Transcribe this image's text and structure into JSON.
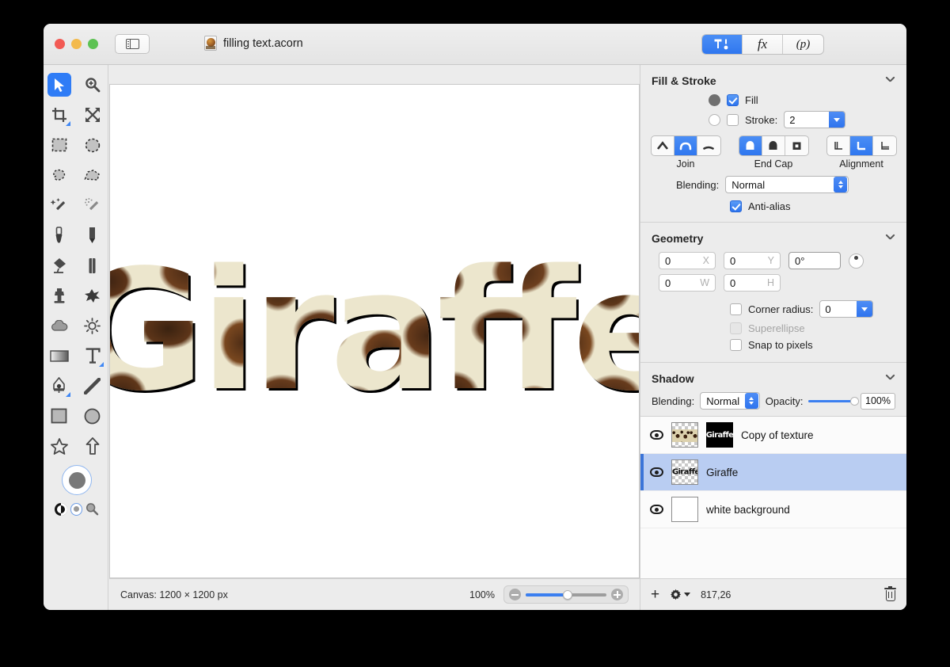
{
  "titlebar": {
    "document_name": "filling text.acorn",
    "sidebar_toggle_icon": "sidebar-icon",
    "segments": [
      {
        "id": "tools",
        "label": "",
        "icon": "hammer-pen-icon",
        "selected": true
      },
      {
        "id": "effects",
        "label": "fx",
        "icon": "fx-icon",
        "selected": false
      },
      {
        "id": "presets",
        "label": "(p)",
        "icon": "p-icon",
        "selected": false
      }
    ]
  },
  "tools": {
    "rows": [
      [
        {
          "name": "move-tool",
          "icon": "arrow-cursor-icon",
          "selected": true
        },
        {
          "name": "zoom-tool",
          "icon": "magnifier-plus-icon",
          "selected": false
        }
      ],
      [
        {
          "name": "crop-tool",
          "icon": "crop-icon",
          "selected": false,
          "badge": true
        },
        {
          "name": "transform-tool",
          "icon": "arrows-expand-icon",
          "selected": false
        }
      ],
      [
        {
          "name": "rect-select-tool",
          "icon": "rect-marquee-icon",
          "selected": false
        },
        {
          "name": "ellipse-select-tool",
          "icon": "ellipse-marquee-icon",
          "selected": false
        }
      ],
      [
        {
          "name": "lasso-tool",
          "icon": "lasso-icon",
          "selected": false
        },
        {
          "name": "polygon-lasso-tool",
          "icon": "polygon-lasso-icon",
          "selected": false
        }
      ],
      [
        {
          "name": "magic-wand-tool",
          "icon": "magic-wand-icon",
          "selected": false
        },
        {
          "name": "instant-alpha-tool",
          "icon": "instant-alpha-icon",
          "selected": false
        }
      ],
      [
        {
          "name": "brush-tool",
          "icon": "brush-icon",
          "selected": false
        },
        {
          "name": "pencil-tool",
          "icon": "pencil-icon",
          "selected": false
        }
      ],
      [
        {
          "name": "paint-bucket-tool",
          "icon": "paint-bucket-icon",
          "selected": false
        },
        {
          "name": "eraser-tool",
          "icon": "eraser-icon",
          "selected": false
        }
      ],
      [
        {
          "name": "clone-stamp-tool",
          "icon": "clone-stamp-icon",
          "selected": false
        },
        {
          "name": "smudge-tool",
          "icon": "smudge-icon",
          "selected": false
        }
      ],
      [
        {
          "name": "blur-tool",
          "icon": "cloud-icon",
          "selected": false
        },
        {
          "name": "dodge-tool",
          "icon": "sun-icon",
          "selected": false
        }
      ],
      [
        {
          "name": "gradient-tool",
          "icon": "gradient-icon",
          "selected": false
        },
        {
          "name": "text-tool",
          "icon": "text-t-icon",
          "selected": false,
          "badge": true
        }
      ],
      [
        {
          "name": "bezier-pen-tool",
          "icon": "pen-nib-icon",
          "selected": false,
          "badge": true
        },
        {
          "name": "line-tool",
          "icon": "line-icon",
          "selected": false
        }
      ],
      [
        {
          "name": "rectangle-tool",
          "icon": "rectangle-icon",
          "selected": false
        },
        {
          "name": "ellipse-tool",
          "icon": "circle-icon",
          "selected": false
        }
      ],
      [
        {
          "name": "star-tool",
          "icon": "star-icon",
          "selected": false
        },
        {
          "name": "arrow-tool",
          "icon": "up-arrow-icon",
          "selected": false
        }
      ]
    ],
    "color_well": {
      "name": "foreground-color-well",
      "color": "#797979"
    },
    "swap_icon": "invert-colors-icon",
    "secondary_swatch_icon": "secondary-color-swatch",
    "picker_icon": "color-picker-magnifier-icon"
  },
  "canvas": {
    "artwork_text": "Giraffe",
    "status_label": "Canvas: 1200 × 1200 px",
    "zoom_percent": "100%",
    "zoom_out_icon": "zoom-out-icon",
    "zoom_in_icon": "zoom-in-icon"
  },
  "inspector": {
    "fill_stroke": {
      "title": "Fill & Stroke",
      "fill_label": "Fill",
      "fill_checked": true,
      "fill_swatch_color": "#707070",
      "stroke_label": "Stroke:",
      "stroke_checked": false,
      "stroke_width": "2",
      "join": {
        "caption": "Join",
        "options": [
          "miter-join-icon",
          "round-join-icon",
          "bevel-join-icon"
        ],
        "selected": 1
      },
      "end_cap": {
        "caption": "End Cap",
        "options": [
          "butt-cap-icon",
          "round-cap-icon",
          "square-cap-icon"
        ],
        "selected": 0
      },
      "alignment": {
        "caption": "Alignment",
        "options": [
          "align-inside-icon",
          "align-center-icon",
          "align-outside-icon"
        ],
        "selected": 1
      },
      "blending_label": "Blending:",
      "blending_value": "Normal",
      "antialias_label": "Anti-alias",
      "antialias_checked": true
    },
    "geometry": {
      "title": "Geometry",
      "x_value": "0",
      "x_suffix": "X",
      "y_value": "0",
      "y_suffix": "Y",
      "rotation_value": "0°",
      "w_value": "0",
      "w_suffix": "W",
      "h_value": "0",
      "h_suffix": "H",
      "corner_radius_label": "Corner radius:",
      "corner_radius_value": "0",
      "corner_radius_checked": false,
      "superellipse_label": "Superellipse",
      "superellipse_checked": false,
      "superellipse_disabled": true,
      "snap_label": "Snap to pixels",
      "snap_checked": false
    },
    "shadow": {
      "title": "Shadow",
      "blending_label": "Blending:",
      "blending_value": "Normal",
      "opacity_label": "Opacity:",
      "opacity_value": "100%"
    }
  },
  "layers": {
    "items": [
      {
        "name": "Copy of texture",
        "visible": true,
        "selected": false,
        "thumb": "texture-thumb",
        "mask_thumb": "Giraffe"
      },
      {
        "name": "Giraffe",
        "visible": true,
        "selected": true,
        "thumb": "text-thumb",
        "thumb_text": "Giraffe"
      },
      {
        "name": "white background",
        "visible": true,
        "selected": false,
        "thumb": "white-thumb"
      }
    ],
    "toolbar": {
      "add_icon": "plus-icon",
      "settings_icon": "gear-icon",
      "coordinates": "817,26",
      "delete_icon": "trash-icon"
    }
  },
  "colors": {
    "accent": "#2f77ef",
    "selection": "#b9cdf2",
    "window_bg": "#ececec"
  }
}
